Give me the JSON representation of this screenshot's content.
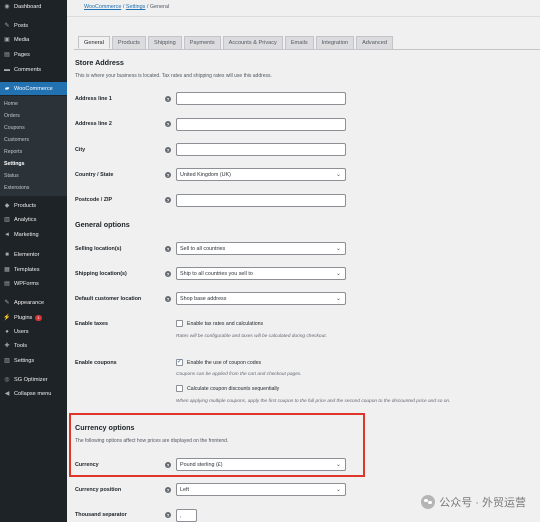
{
  "sidebar": {
    "dashboard": "Dashboard",
    "posts": "Posts",
    "media": "Media",
    "pages": "Pages",
    "comments": "Comments",
    "woocommerce": "WooCommerce",
    "woo_sub": [
      "Home",
      "Orders",
      "Coupons",
      "Customers",
      "Reports",
      "Settings",
      "Status",
      "Extensions"
    ],
    "products": "Products",
    "analytics": "Analytics",
    "marketing": "Marketing",
    "elementor": "Elementor",
    "templates": "Templates",
    "wpforms": "WPForms",
    "appearance": "Appearance",
    "plugins": "Plugins",
    "plugins_badge": "1",
    "users": "Users",
    "tools": "Tools",
    "settings": "Settings",
    "sg_optimizer": "SG Optimizer",
    "collapse": "Collapse menu"
  },
  "breadcrumb": {
    "woocommerce": "WooCommerce",
    "sep1": " / ",
    "settings": "Settings",
    "sep2": " / ",
    "current": "General"
  },
  "tabs": [
    "General",
    "Products",
    "Shipping",
    "Payments",
    "Accounts & Privacy",
    "Emails",
    "Integration",
    "Advanced"
  ],
  "store_address": {
    "heading": "Store Address",
    "description": "This is where your business is located. Tax rates and shipping rates will use this address.",
    "address1_label": "Address line 1",
    "address1_value": "",
    "address2_label": "Address line 2",
    "address2_value": "",
    "city_label": "City",
    "city_value": "",
    "country_label": "Country / State",
    "country_value": "United Kingdom (UK)",
    "postcode_label": "Postcode / ZIP",
    "postcode_value": ""
  },
  "general_options": {
    "heading": "General options",
    "selling_label": "Selling location(s)",
    "selling_value": "Sell to all countries",
    "shipping_label": "Shipping location(s)",
    "shipping_value": "Ship to all countries you sell to",
    "default_customer_label": "Default customer location",
    "default_customer_value": "Shop base address",
    "enable_taxes_label": "Enable taxes",
    "enable_taxes_cb": "Enable tax rates and calculations",
    "enable_taxes_note": "Rates will be configurable and taxes will be calculated during checkout.",
    "enable_coupons_label": "Enable coupons",
    "coupon_codes_cb": "Enable the use of coupon codes",
    "coupon_codes_note": "Coupons can be applied from the cart and checkout pages.",
    "coupon_seq_cb": "Calculate coupon discounts sequentially",
    "coupon_seq_note": "When applying multiple coupons, apply the first coupon to the full price and the second coupon to the discounted price and so on."
  },
  "currency_options": {
    "heading": "Currency options",
    "description": "The following options affect how prices are displayed on the frontend.",
    "currency_label": "Currency",
    "currency_value": "Pound sterling (£)",
    "position_label": "Currency position",
    "position_value": "Left",
    "thousand_label": "Thousand separator",
    "thousand_value": ","
  },
  "watermark": {
    "text": "公众号 · 外贸运营"
  },
  "colors": {
    "sidebar_bg": "#1d2327",
    "accent": "#2271b1",
    "highlight_box": "#e0352b"
  }
}
